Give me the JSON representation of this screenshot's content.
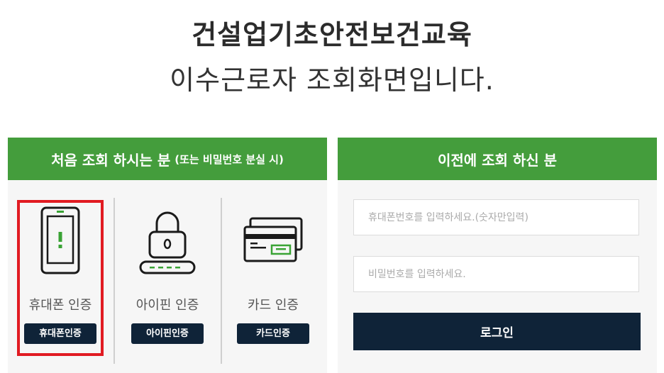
{
  "header": {
    "title": "건설업기초안전보건교육",
    "subtitle": "이수근로자 조회화면입니다."
  },
  "left_panel": {
    "heading": "처음 조회 하시는 분",
    "heading_sub": "(또는 비밀번호 분실 시)",
    "methods": [
      {
        "label": "휴대폰 인증",
        "button": "휴대폰인증",
        "icon": "smartphone-icon"
      },
      {
        "label": "아이핀 인증",
        "button": "아이핀인증",
        "icon": "padlock-icon"
      },
      {
        "label": "카드 인증",
        "button": "카드인증",
        "icon": "credit-card-icon"
      }
    ],
    "selected_method": 0
  },
  "right_panel": {
    "heading": "이전에 조회 하신 분",
    "phone_placeholder": "휴대폰번호를 입력하세요.(숫자만입력)",
    "password_placeholder": "비밀번호를 입력하세요.",
    "login_button": "로그인"
  },
  "colors": {
    "header_green": "#449d3c",
    "button_navy": "#0f2338",
    "highlight_red": "#e11b22",
    "icon_green": "#3aa335"
  }
}
